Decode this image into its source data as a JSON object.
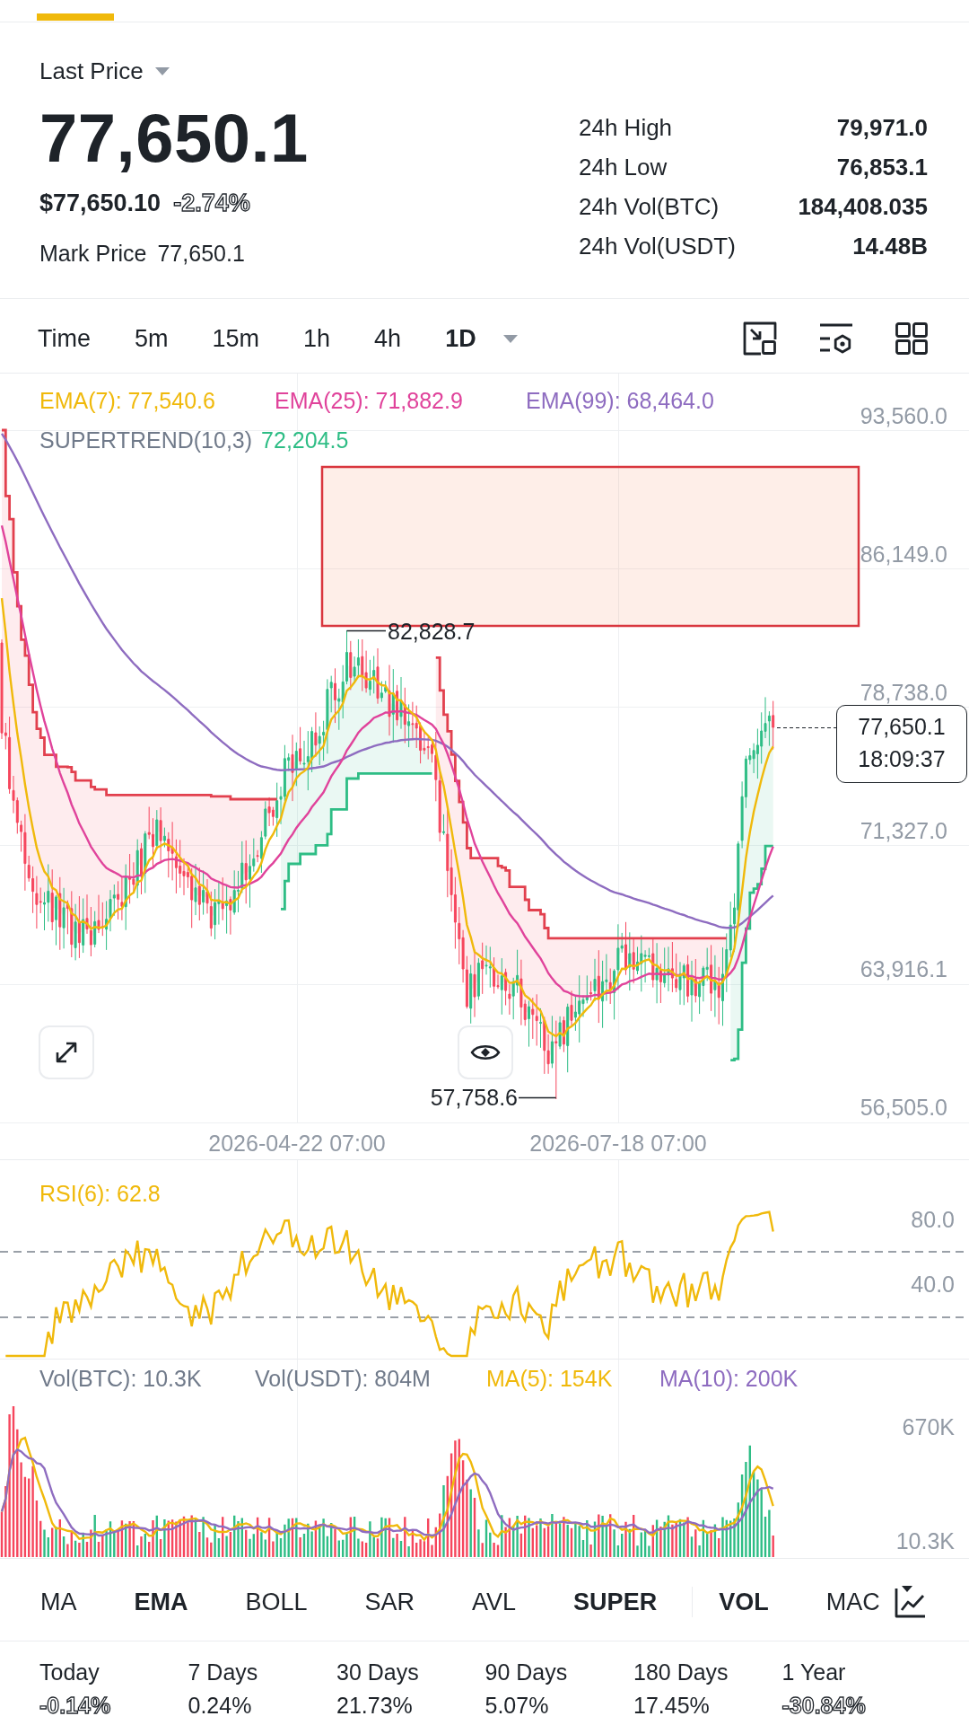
{
  "price_header": {
    "label": "Last Price",
    "last_price": "77,650.1",
    "usd_price": "$77,650.10",
    "change": "-2.74%",
    "change_negative": true,
    "mark_price_label": "Mark Price",
    "mark_price": "77,650.1"
  },
  "stats": [
    {
      "label": "24h High",
      "value": "79,971.0"
    },
    {
      "label": "24h Low",
      "value": "76,853.1"
    },
    {
      "label": "24h Vol(BTC)",
      "value": "184,408.035"
    },
    {
      "label": "24h Vol(USDT)",
      "value": "14.48B"
    }
  ],
  "timeframes": [
    {
      "label": "Time",
      "selected": false,
      "dropdown": false
    },
    {
      "label": "5m",
      "selected": false,
      "dropdown": false
    },
    {
      "label": "15m",
      "selected": false,
      "dropdown": false
    },
    {
      "label": "1h",
      "selected": false,
      "dropdown": false
    },
    {
      "label": "4h",
      "selected": false,
      "dropdown": false
    },
    {
      "label": "1D",
      "selected": true,
      "dropdown": true
    }
  ],
  "chart": {
    "ema_legend": [
      {
        "text": "EMA(7): 77,540.6",
        "color": "#f0b90b"
      },
      {
        "text": "EMA(25): 71,882.9",
        "color": "#e0439b"
      },
      {
        "text": "EMA(99): 68,464.0",
        "color": "#8e6cc0"
      }
    ],
    "supertrend": {
      "label": "SUPERTREND(10,3)",
      "value": "72,204.5"
    },
    "price_axis": [
      "93,560.0",
      "86,149.0",
      "78,738.0",
      "71,327.0",
      "63,916.1",
      "56,505.0"
    ],
    "time_axis": [
      "2026-04-22 07:00",
      "2026-07-18 07:00"
    ],
    "high_label": "82,828.7",
    "low_label": "57,758.6",
    "current_price": "77,650.1",
    "countdown": "18:09:37"
  },
  "rsi": {
    "legend": "RSI(6): 62.8",
    "axis": [
      "80.0",
      "40.0"
    ]
  },
  "volume": {
    "legend": [
      {
        "text": "Vol(BTC): 10.3K",
        "color": "#707a8a"
      },
      {
        "text": "Vol(USDT): 804M",
        "color": "#707a8a"
      },
      {
        "text": "MA(5): 154K",
        "color": "#f0b90b"
      },
      {
        "text": "MA(10): 200K",
        "color": "#8e6cc0"
      }
    ],
    "axis": [
      "670K",
      "10.3K"
    ]
  },
  "indicators": {
    "main": [
      {
        "label": "MA",
        "selected": false
      },
      {
        "label": "EMA",
        "selected": true
      },
      {
        "label": "BOLL",
        "selected": false
      },
      {
        "label": "SAR",
        "selected": false
      },
      {
        "label": "AVL",
        "selected": false
      },
      {
        "label": "SUPER",
        "selected": true
      }
    ],
    "sub": [
      {
        "label": "VOL",
        "selected": true
      },
      {
        "label": "MAC",
        "selected": false
      }
    ]
  },
  "performance": [
    {
      "period": "Today",
      "change": "-0.14%",
      "negative": true
    },
    {
      "period": "7 Days",
      "change": "0.24%",
      "negative": false
    },
    {
      "period": "30 Days",
      "change": "21.73%",
      "negative": false
    },
    {
      "period": "90 Days",
      "change": "5.07%",
      "negative": false
    },
    {
      "period": "180 Days",
      "change": "17.45%",
      "negative": false
    },
    {
      "period": "1 Year",
      "change": "-30.84%",
      "negative": true
    }
  ]
}
